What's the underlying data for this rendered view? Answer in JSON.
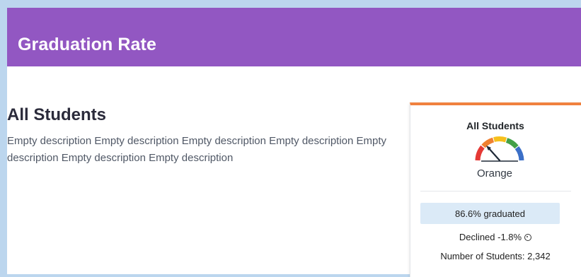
{
  "header": {
    "title": "Graduation Rate"
  },
  "section": {
    "title": "All Students",
    "description": "Empty description Empty description Empty description Empty description Empty description Empty description Empty description"
  },
  "card": {
    "title": "All Students",
    "gauge": {
      "icon": "gauge-icon",
      "segments": [
        "#e53935",
        "#f08030",
        "#f6c01c",
        "#43a047",
        "#3b6fc7"
      ],
      "needle_color": "#1f2937"
    },
    "status_label": "Orange",
    "status_color": "#f0813e",
    "rate_text": "86.6% graduated",
    "change_text": "Declined -1.8%",
    "change_icon": "arrow-down-circle-icon",
    "count_text": "Number of Students: 2,342"
  },
  "colors": {
    "banner": "#9257c2",
    "card_accent": "#f0813e",
    "stat_box": "#dbeaf7"
  }
}
